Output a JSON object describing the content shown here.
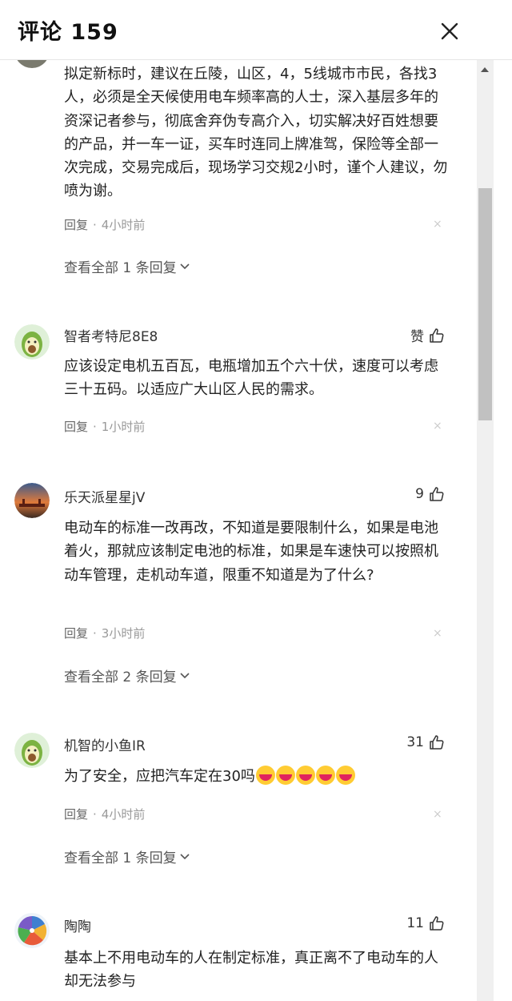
{
  "header": {
    "title": "评论 159",
    "close_icon": "close-icon"
  },
  "comments": [
    {
      "text": "拟定新标时，建议在丘陵，山区，4，5线城市市民，各找3人，必须是全天候使用电车频率高的人士，深入基层多年的资深记者参与，彻底舍弃伪专高介入，切实解决好百姓想要的产品，并一车一证，买车时连同上牌准驾，保险等全部一次完成，交易完成后，现场学习交规2小时，谨个人建议，勿喷为谢。",
      "reply_label": "回复",
      "separator": "·",
      "time": "4小时前",
      "close_label": "×",
      "view_all": "查看全部 1 条回复"
    },
    {
      "username": "智者考特尼8E8",
      "likes": "赞",
      "text": "应该设定电机五百瓦，电瓶增加五个六十伏，速度可以考虑三十五码。以适应广大山区人民的需求。",
      "reply_label": "回复",
      "separator": "·",
      "time": "1小时前",
      "close_label": "×"
    },
    {
      "username": "乐天派星星jV",
      "likes": "9",
      "text": "电动车的标准一改再改，不知道是要限制什么，如果是电池着火，那就应该制定电池的标准，如果是车速快可以按照机动车管理，走机动车道，限重不知道是为了什么?",
      "reply_label": "回复",
      "separator": "·",
      "time": "3小时前",
      "close_label": "×",
      "view_all": "查看全部 2 条回复"
    },
    {
      "username": "机智的小鱼IR",
      "likes": "31",
      "text": "为了安全，应把汽车定在30吗",
      "emoji_count": 5,
      "reply_label": "回复",
      "separator": "·",
      "time": "4小时前",
      "close_label": "×",
      "view_all": "查看全部 1 条回复"
    },
    {
      "username": "陶陶",
      "likes": "11",
      "text": "基本上不用电动车的人在制定标准，真正离不了电动车的人却无法参与"
    }
  ],
  "colors": {
    "accent": "#222222",
    "muted": "#999999",
    "avocado": "#7cb342"
  }
}
